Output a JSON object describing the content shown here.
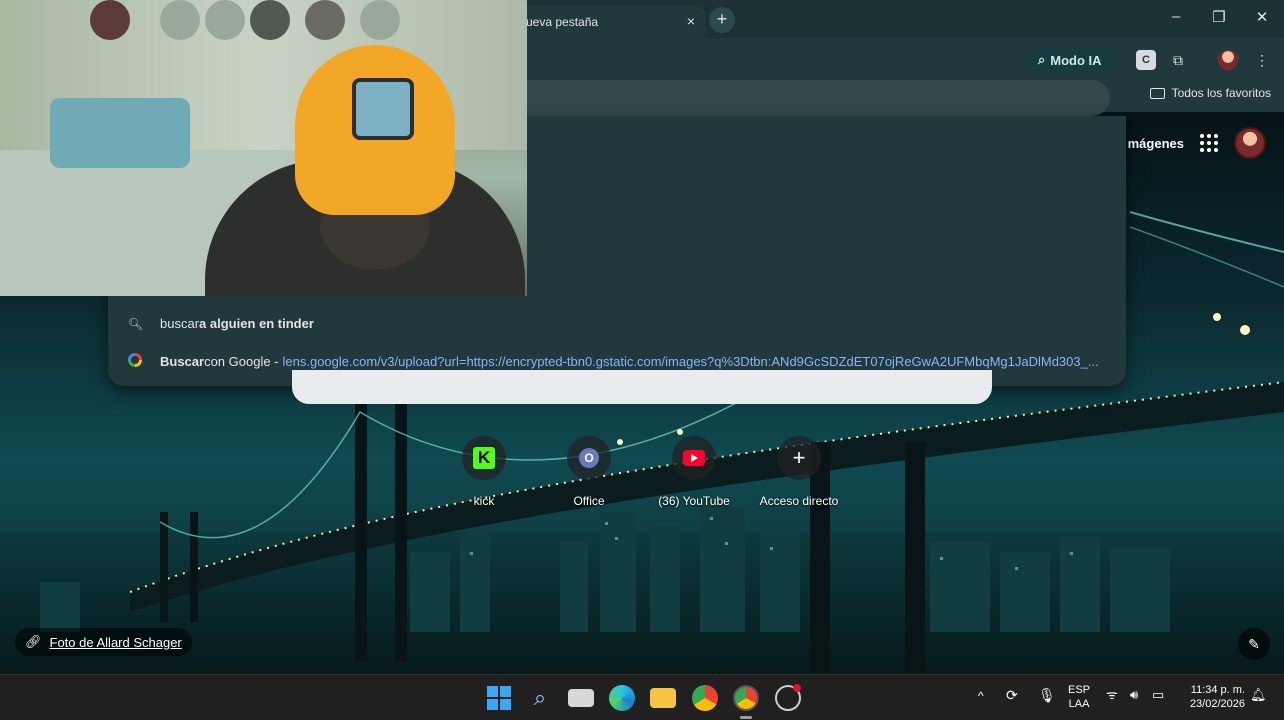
{
  "browser": {
    "active_tab_title": "ueva pestaña",
    "tab_close_glyph": "×",
    "new_tab_glyph": "+",
    "window_controls": [
      "–",
      "❐",
      "✕"
    ],
    "modo_ia_label": "Modo IA",
    "bookmarks_all_label": "Todos los favoritos"
  },
  "ntp": {
    "images_link": "mágenes",
    "shortcuts": [
      {
        "label": "kick",
        "icon": "kick-icon"
      },
      {
        "label": "Office",
        "icon": "office-icon"
      },
      {
        "label": "(36) YouTube",
        "icon": "youtube-icon"
      },
      {
        "label": "Acceso directo",
        "icon": "plus-icon"
      }
    ],
    "photo_credit": "Foto de Allard Schager"
  },
  "omnibox_dropdown": {
    "suggestion_1_prefix": "buscar",
    "suggestion_1_bold": " a alguien en tinder",
    "suggestion_2_bold": "Buscar",
    "suggestion_2_text": " con Google - ",
    "suggestion_2_url": "lens.google.com/v3/upload?url=https://encrypted-tbn0.gstatic.com/images?q%3Dtbn:ANd9GcSDZdET07ojReGwA2UFMbqMg1JaDlMd303_..."
  },
  "taskbar": {
    "lang_top": "ESP",
    "lang_bottom": "LAA",
    "time": "11:34 p. m.",
    "date": "23/02/2026"
  },
  "colors": {
    "accent": "#8ab4f8",
    "chrome_bg": "#21393d",
    "kick_green": "#53fc18",
    "youtube_red": "#ff0033"
  }
}
